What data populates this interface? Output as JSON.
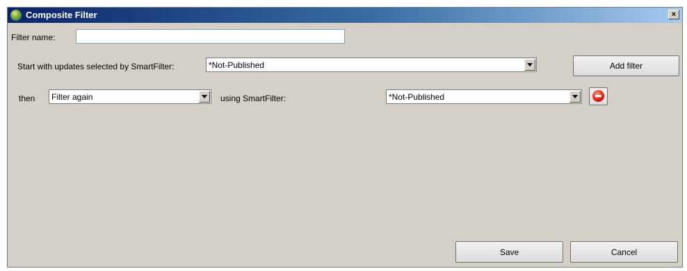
{
  "window": {
    "title": "Composite Filter",
    "close_label": "×"
  },
  "filter_name": {
    "label": "Filter name:",
    "value": ""
  },
  "start": {
    "label": "Start with updates selected by SmartFilter:",
    "selected": "*Not-Published"
  },
  "add_filter_label": "Add filter",
  "row": {
    "then_label": "then",
    "operation_selected": "Filter again",
    "using_label": "using SmartFilter:",
    "smartfilter_selected": "*Not-Published"
  },
  "footer": {
    "save_label": "Save",
    "cancel_label": "Cancel"
  },
  "icons": {
    "app": "app-globe-icon",
    "remove": "remove-filter-icon"
  }
}
